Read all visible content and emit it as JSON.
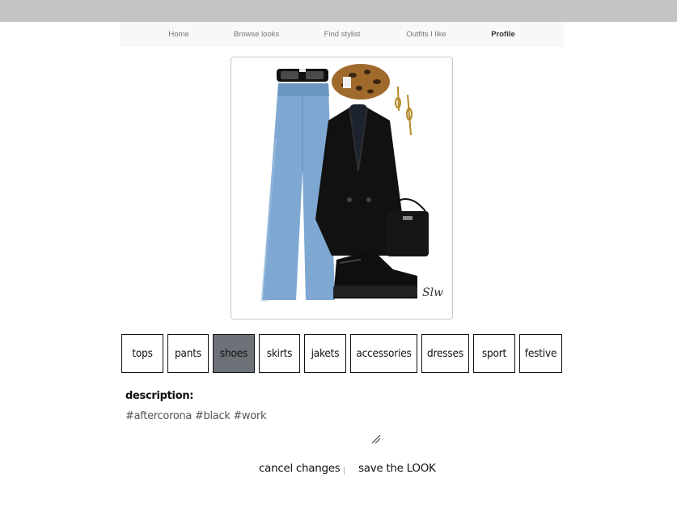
{
  "nav": {
    "items": [
      {
        "label": "Home"
      },
      {
        "label": "Browse looks"
      },
      {
        "label": "Find stylist"
      },
      {
        "label": "Outfits I like"
      },
      {
        "label": "Profile"
      }
    ],
    "active": "Profile"
  },
  "look_image": {
    "items": [
      "sunglasses",
      "leopard-beret",
      "earrings",
      "jeans",
      "black-blazer",
      "crossbody-bag",
      "chunky-shoes"
    ],
    "signature": "Slw"
  },
  "categories": {
    "items": [
      {
        "label": "tops"
      },
      {
        "label": "pants"
      },
      {
        "label": "shoes"
      },
      {
        "label": "skirts"
      },
      {
        "label": "jakets"
      },
      {
        "label": "accessories"
      },
      {
        "label": "dresses"
      },
      {
        "label": "sport"
      },
      {
        "label": "festive"
      }
    ],
    "selected": "shoes"
  },
  "description": {
    "label": "description:",
    "value": "#aftercorona #black #work"
  },
  "actions": {
    "cancel_label": "cancel changes",
    "save_label": "save the LOOK"
  },
  "colors": {
    "topbar": "#c4c4c4",
    "nav_background": "#f7f8f9",
    "selected_category": "#6c7178"
  }
}
